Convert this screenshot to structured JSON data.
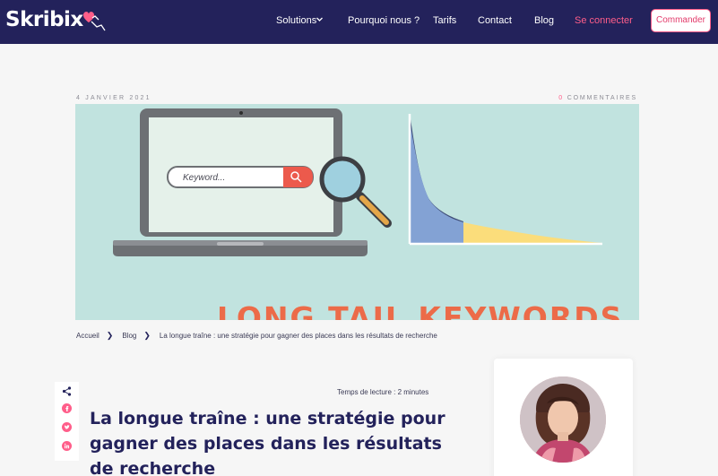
{
  "brand": {
    "name": "Skribix"
  },
  "nav": {
    "solutions": "Solutions",
    "pourquoi": "Pourquoi nous ?",
    "tarifs": "Tarifs",
    "contact": "Contact",
    "blog": "Blog",
    "login": "Se connecter",
    "cta": "Commander"
  },
  "meta": {
    "date": "4 janvier 2021",
    "comment_count": "0",
    "comment_label": "commentaires"
  },
  "hero": {
    "search_text": "Keyword...",
    "title": "LONG TAIL KEYWORDS"
  },
  "breadcrumb": {
    "home": "Accueil",
    "blog": "Blog",
    "current": "La longue traîne : une stratégie pour gagner des places dans les résultats de recherche"
  },
  "article": {
    "reading_time": "Temps de lecture : 2 minutes",
    "title": "La longue traîne : une stratégie pour gagner des places dans les résultats de recherche"
  },
  "colors": {
    "header": "#23225b",
    "accent": "#ff5e8a",
    "hero_bg": "#c1e3df"
  }
}
